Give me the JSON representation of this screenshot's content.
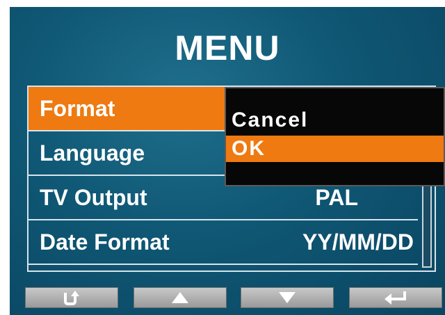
{
  "title": "MENU",
  "menu": {
    "items": [
      {
        "label": "Format",
        "value": ""
      },
      {
        "label": "Language",
        "value": ""
      },
      {
        "label": "TV Output",
        "value": "PAL"
      },
      {
        "label": "Date Format",
        "value": "YY/MM/DD"
      }
    ],
    "selected_index": 0
  },
  "popup": {
    "options": [
      "Cancel",
      "OK"
    ],
    "selected_index": 1
  },
  "buttons": [
    {
      "icon": "back-icon"
    },
    {
      "icon": "up-arrow-icon"
    },
    {
      "icon": "down-arrow-icon"
    },
    {
      "icon": "enter-icon"
    }
  ],
  "colors": {
    "accent": "#ee7a11",
    "background": "#0f5774",
    "popup": "#070707"
  }
}
